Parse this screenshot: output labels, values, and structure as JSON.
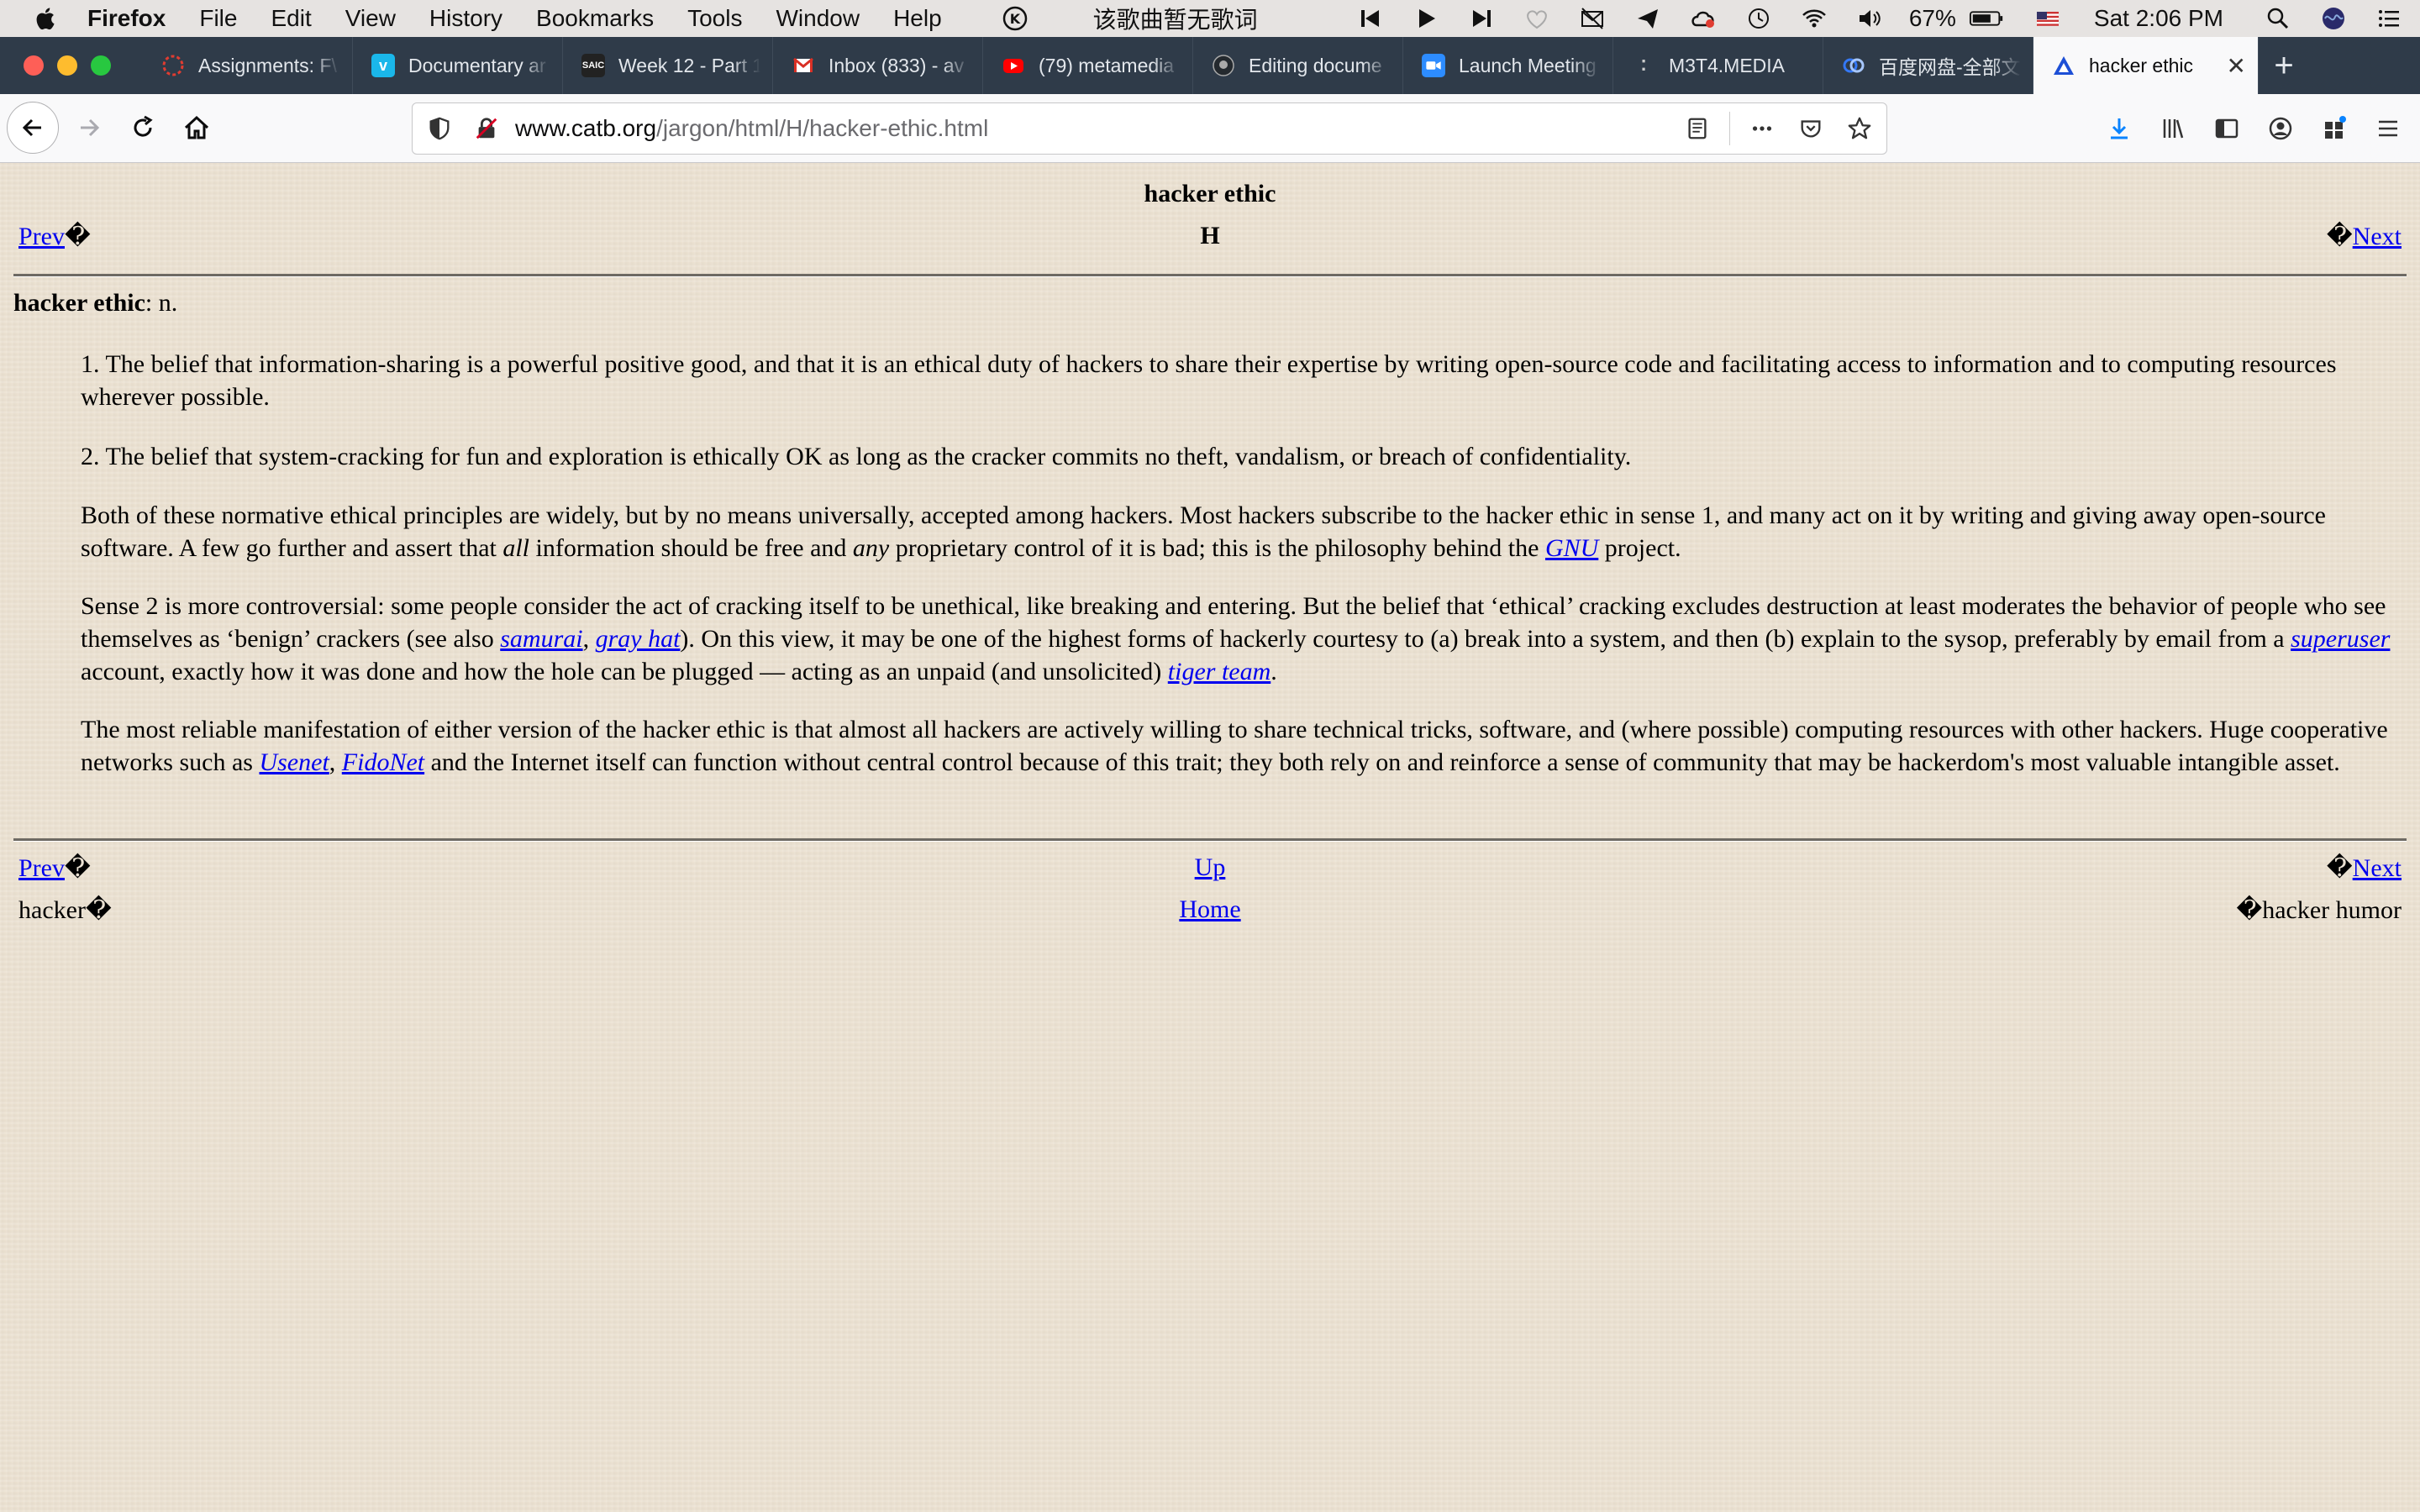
{
  "menubar": {
    "app_name": "Firefox",
    "items": [
      "File",
      "Edit",
      "View",
      "History",
      "Bookmarks",
      "Tools",
      "Window",
      "Help"
    ],
    "lyrics_text": "该歌曲暂无歌词",
    "battery": "67%",
    "clock": "Sat 2:06 PM"
  },
  "tabs": [
    {
      "label": "Assignments: F\\",
      "icon": "canvas-icon",
      "color": "#e03c31"
    },
    {
      "label": "Documentary ar",
      "icon": "vimeo-icon",
      "color": "#1ab7ea"
    },
    {
      "label": "Week 12 - Part 1",
      "icon": "saic-icon",
      "color": "#222222"
    },
    {
      "label": "Inbox (833) - av",
      "icon": "gmail-icon",
      "color": "#d93025"
    },
    {
      "label": "(79) metamedia",
      "icon": "youtube-icon",
      "color": "#ff0000"
    },
    {
      "label": "Editing docume",
      "icon": "github-icon",
      "color": "#24292e"
    },
    {
      "label": "Launch Meeting",
      "icon": "zoom-icon",
      "color": "#2d8cff"
    },
    {
      "label": "M3T4.MEDIA",
      "icon": "dots-icon",
      "color": "#2f3b49"
    },
    {
      "label": "百度网盘-全部文",
      "icon": "baidu-icon",
      "color": "#3478f6"
    },
    {
      "label": "hacker ethic",
      "icon": "catb-icon",
      "color": "#1d4fd6",
      "active": true
    }
  ],
  "navbar": {
    "url_host": "www.catb.org",
    "url_path": "/jargon/html/H/hacker-ethic.html"
  },
  "page": {
    "title": "hacker ethic",
    "section": "H",
    "prev": "Prev",
    "next": "Next",
    "replacement_char": "�",
    "term": "hacker ethic",
    "pos": ": n.",
    "sense1": "1. The belief that information-sharing is a powerful positive good, and that it is an ethical duty of hackers to share their expertise by writing open-source code and facilitating access to information and to computing resources wherever possible.",
    "sense2": "2. The belief that system-cracking for fun and exploration is ethically OK as long as the cracker commits no theft, vandalism, or breach of confidentiality.",
    "p3": {
      "a": "Both of these normative ethical principles are widely, but by no means universally, accepted among hackers. Most hackers subscribe to the hacker ethic in sense 1, and many act on it by writing and giving away open-source software. A few go further and assert that ",
      "all": "all",
      "b": " information should be free and ",
      "any": "any",
      "c": " proprietary control of it is bad; this is the philosophy behind the ",
      "gnu": "GNU",
      "d": " project."
    },
    "p4": {
      "a": "Sense 2 is more controversial: some people consider the act of cracking itself to be unethical, like breaking and entering. But the belief that ‘ethical’ cracking excludes destruction at least moderates the behavior of people who see themselves as ‘benign’ crackers (see also ",
      "samurai": "samurai",
      "comma": ", ",
      "grayhat": "gray hat",
      "b": "). On this view, it may be one of the highest forms of hackerly courtesy to (a) break into a system, and then (b) explain to the sysop, preferably by email from a ",
      "superuser": "superuser",
      "c": " account, exactly how it was done and how the hole can be plugged — acting as an unpaid (and unsolicited) ",
      "tigerteam": "tiger team",
      "d": "."
    },
    "p5": {
      "a": "The most reliable manifestation of either version of the hacker ethic is that almost all hackers are actively willing to share technical tricks, software, and (where possible) computing resources with other hackers. Huge cooperative networks such as ",
      "usenet": "Usenet",
      "comma": ", ",
      "fidonet": "FidoNet",
      "b": " and the Internet itself can function without central control because of this trait; they both rely on and reinforce a sense of community that may be hackerdom's most valuable intangible asset."
    },
    "footer": {
      "prev": "Prev",
      "up": "Up",
      "next": "Next",
      "prev_title": "hacker",
      "home": "Home",
      "next_title": "hacker humor"
    }
  }
}
